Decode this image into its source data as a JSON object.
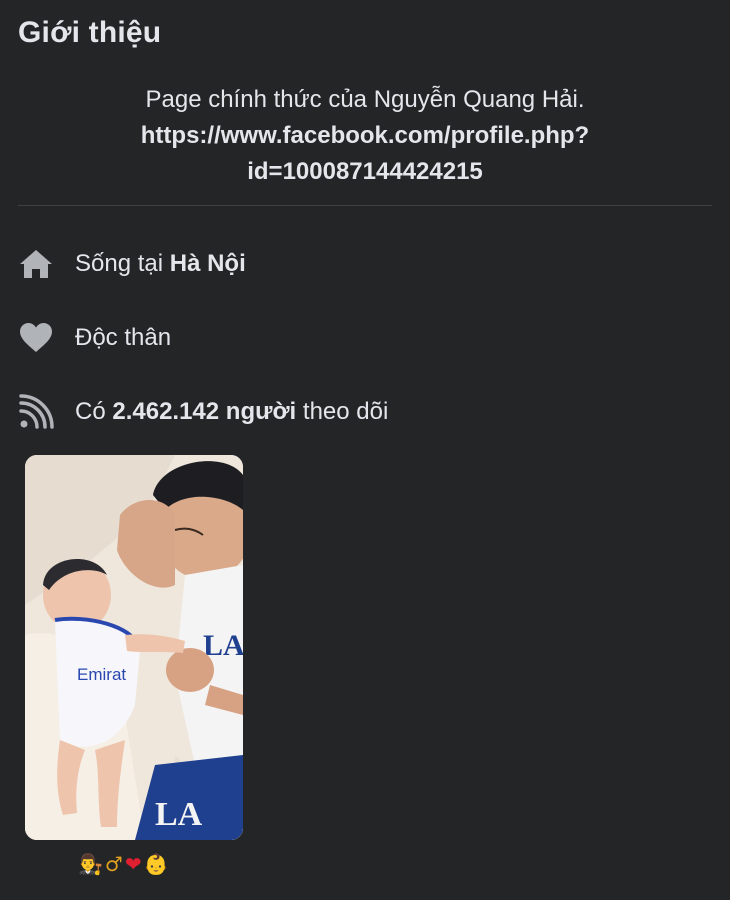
{
  "section": {
    "title": "Giới thiệu"
  },
  "bio": {
    "text": "Page chính thức của Nguyễn Quang Hải.",
    "link_line1": "https://www.facebook.com/profile.php?",
    "link_line2": "id=100087144424215"
  },
  "info": {
    "home_prefix": "Sống tại",
    "home_city": "Hà Nội",
    "relationship": "Độc thân",
    "followers_prefix": "Có",
    "followers_count": "2.462.142 người",
    "followers_suffix": "theo dõi"
  },
  "featured": {
    "caption_emojis": [
      "👨‍⚖️",
      "♂",
      "❤",
      "👶"
    ]
  },
  "colors": {
    "background": "#242526",
    "text": "#e4e6eb",
    "icon": "#b0b3b8",
    "divider": "#3e4042"
  },
  "icons": {
    "home": "home-icon",
    "relationship": "heart-icon",
    "followers": "rss-icon"
  }
}
